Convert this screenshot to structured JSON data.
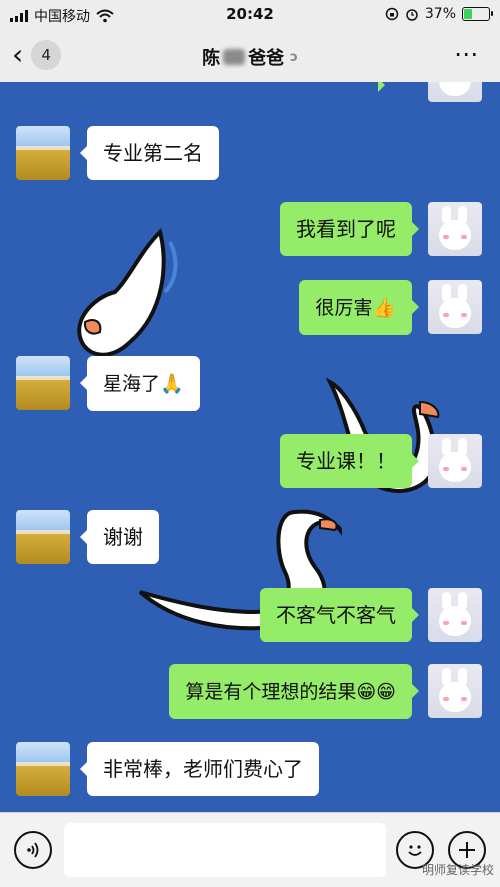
{
  "status_bar": {
    "carrier": "中国移动",
    "time": "20:42",
    "battery_text": "37%",
    "battery_level": 0.37,
    "wifi_icon": "wifi-icon"
  },
  "nav": {
    "back_icon": "chevron-left-icon",
    "unread_count": "4",
    "title_part1": "陈",
    "title_part2": "爸爸",
    "ear_icon": "ear-icon",
    "more_icon": "⋯"
  },
  "messages": [
    {
      "side": "in",
      "text": "专业第二名"
    },
    {
      "side": "out",
      "text": "我看到了呢"
    },
    {
      "side": "out",
      "text": "很厉害👍"
    },
    {
      "side": "in",
      "text": "星海了🙏"
    },
    {
      "side": "out",
      "text": "专业课！！"
    },
    {
      "side": "in",
      "text": "谢谢"
    },
    {
      "side": "out",
      "text": "不客气不客气"
    },
    {
      "side": "out",
      "text": "算是有个理想的结果😁😁"
    },
    {
      "side": "in",
      "text": "非常棒，老师们费心了"
    }
  ],
  "input_bar": {
    "voice_icon": "voice-icon",
    "emoji_icon": "emoji-icon",
    "plus_icon": "plus-icon",
    "watermark": "明师复读学校"
  },
  "colors": {
    "chat_bg": "#2f5fb4",
    "bubble_out": "#95ec69",
    "bubble_in": "#ffffff"
  }
}
